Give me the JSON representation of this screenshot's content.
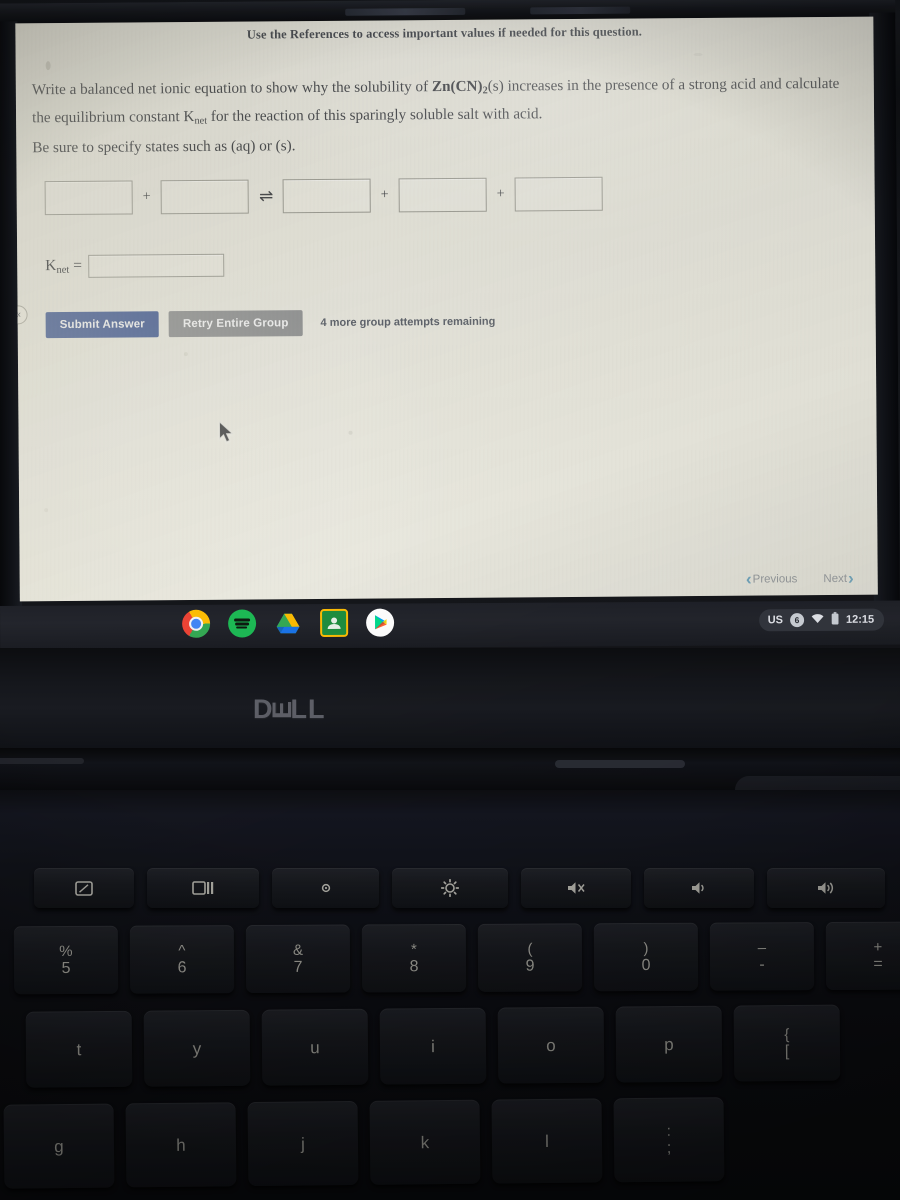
{
  "screen": {
    "references_note": "Use the References to access important values if needed for this question.",
    "question": {
      "line1_a": "Write a balanced net ionic equation to show why the solubility of ",
      "formula": "Zn(CN)",
      "formula_sub": "2",
      "formula_state": "(s)",
      "line1_b": " increases in the presence of a strong acid and calculate",
      "line2_a": "the equilibrium constant K",
      "line2_sub": "net",
      "line2_b": " for the reaction of this sparingly soluble salt with acid.",
      "states_note": "Be sure to specify states such as (aq) or (s)."
    },
    "equation": {
      "boxes": [
        "",
        "",
        "",
        "",
        ""
      ],
      "placeholders": [
        "",
        "",
        "",
        "",
        ""
      ],
      "operators": [
        "+",
        "⇌",
        "+",
        "+"
      ]
    },
    "knet": {
      "label": "K",
      "label_sub": "net",
      "equals": "=",
      "value": "",
      "placeholder": ""
    },
    "buttons": {
      "submit_label": "Submit Answer",
      "retry_label": "Retry Entire Group",
      "attempts_text": "4 more group attempts remaining",
      "submit_color": "#1e3f8f",
      "retry_color": "#7b7d80"
    },
    "navigation": {
      "previous_label": "Previous",
      "next_label": "Next",
      "prev_chevron": "‹",
      "next_chevron": "›",
      "chevron_color": "#2a88b8"
    },
    "collapse_handle_glyph": "«"
  },
  "shelf": {
    "apps": [
      {
        "name": "chrome-icon",
        "label": "Chrome"
      },
      {
        "name": "spotify-icon",
        "label": "Spotify"
      },
      {
        "name": "google-drive-icon",
        "label": "Google Drive"
      },
      {
        "name": "google-classroom-icon",
        "label": "Google Classroom"
      },
      {
        "name": "play-store-icon",
        "label": "Play Store"
      }
    ],
    "tray": {
      "keyboard_layout": "US",
      "notification_count": "6",
      "wifi_icon": "wifi-icon",
      "battery_icon": "battery-icon",
      "time": "12:15"
    }
  },
  "laptop": {
    "brand": "DELL",
    "brand_d": "D",
    "brand_e": "E",
    "brand_ll": "LL"
  },
  "keyboard": {
    "function_row": [
      {
        "name": "fullscreen-key",
        "icon": "fullscreen"
      },
      {
        "name": "overview-windows-key",
        "icon": "overview"
      },
      {
        "name": "brightness-down-key",
        "icon": "brightness-low"
      },
      {
        "name": "brightness-up-key",
        "icon": "brightness-high"
      },
      {
        "name": "mute-key",
        "icon": "mute"
      },
      {
        "name": "volume-down-key",
        "icon": "volume-low"
      },
      {
        "name": "volume-up-key",
        "icon": "volume-high"
      }
    ],
    "number_row": [
      {
        "name": "key-5",
        "top": "%",
        "bot": "5"
      },
      {
        "name": "key-6",
        "top": "^",
        "bot": "6"
      },
      {
        "name": "key-7",
        "top": "&",
        "bot": "7"
      },
      {
        "name": "key-8",
        "top": "*",
        "bot": "8"
      },
      {
        "name": "key-9",
        "top": "(",
        "bot": "9"
      },
      {
        "name": "key-0",
        "top": ")",
        "bot": "0"
      },
      {
        "name": "key-minus",
        "top": "–",
        "bot": "-"
      },
      {
        "name": "key-equals",
        "top": "+",
        "bot": "="
      }
    ],
    "top_letter_row": [
      {
        "name": "key-t",
        "bot": "t"
      },
      {
        "name": "key-y",
        "bot": "y"
      },
      {
        "name": "key-u",
        "bot": "u"
      },
      {
        "name": "key-i",
        "bot": "i"
      },
      {
        "name": "key-o",
        "bot": "o"
      },
      {
        "name": "key-p",
        "bot": "p"
      },
      {
        "name": "key-bracket-left",
        "top": "{",
        "bot": "["
      }
    ],
    "home_letter_row": [
      {
        "name": "key-g",
        "bot": "g"
      },
      {
        "name": "key-h",
        "bot": "h"
      },
      {
        "name": "key-j",
        "bot": "j"
      },
      {
        "name": "key-k",
        "bot": "k"
      },
      {
        "name": "key-l",
        "bot": "l"
      },
      {
        "name": "key-semicolon",
        "top": ":",
        "bot": ";"
      }
    ]
  }
}
